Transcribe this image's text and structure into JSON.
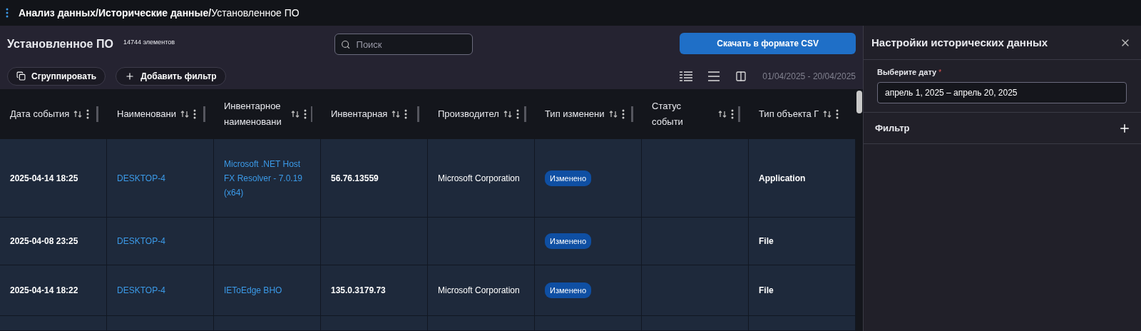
{
  "breadcrumb": {
    "parts": [
      "Анализ данных/",
      "Исторические данные/"
    ],
    "current": "Установленное ПО"
  },
  "page": {
    "title": "Установленное ПО",
    "count": "14744 элементов"
  },
  "search": {
    "placeholder": "Поиск"
  },
  "download_button": "Скачать в формате CSV",
  "group_button": "Сгруппировать",
  "add_filter_button": "Добавить фильтр",
  "date_range": "01/04/2025 - 20/04/2025",
  "table": {
    "columns": [
      {
        "label": "Дата события"
      },
      {
        "label": "Наименовани"
      },
      {
        "label": "Инвентарное наименовани"
      },
      {
        "label": "Инвентарная"
      },
      {
        "label": "Производител"
      },
      {
        "label": "Тип изменени"
      },
      {
        "label": "Статус событи"
      },
      {
        "label": "Тип объекта Г"
      }
    ],
    "rows": [
      {
        "date": "2025-04-14 18:25",
        "host": "DESKTOP-4",
        "inventory_name": "Microsoft .NET Host FX Resolver - 7.0.19 (x64)",
        "version": "56.76.13559",
        "vendor": "Microsoft Corporation",
        "change": "Изменено",
        "object_type": "Application"
      },
      {
        "date": "2025-04-08 23:25",
        "host": "DESKTOP-4",
        "change": "Изменено",
        "object_type": "File"
      },
      {
        "date": "2025-04-14 18:22",
        "host": "DESKTOP-4",
        "inventory_name": "IEToEdge BHO",
        "version": "135.0.3179.73",
        "vendor": "Microsoft Corporation",
        "change": "Изменено",
        "object_type": "File"
      }
    ]
  },
  "settings_panel": {
    "title": "Настройки исторических данных",
    "date_label": "Выберите дату",
    "date_required_mark": "*",
    "date_value": "апрель 1, 2025 – апрель 20, 2025",
    "filter_label": "Фильтр"
  }
}
